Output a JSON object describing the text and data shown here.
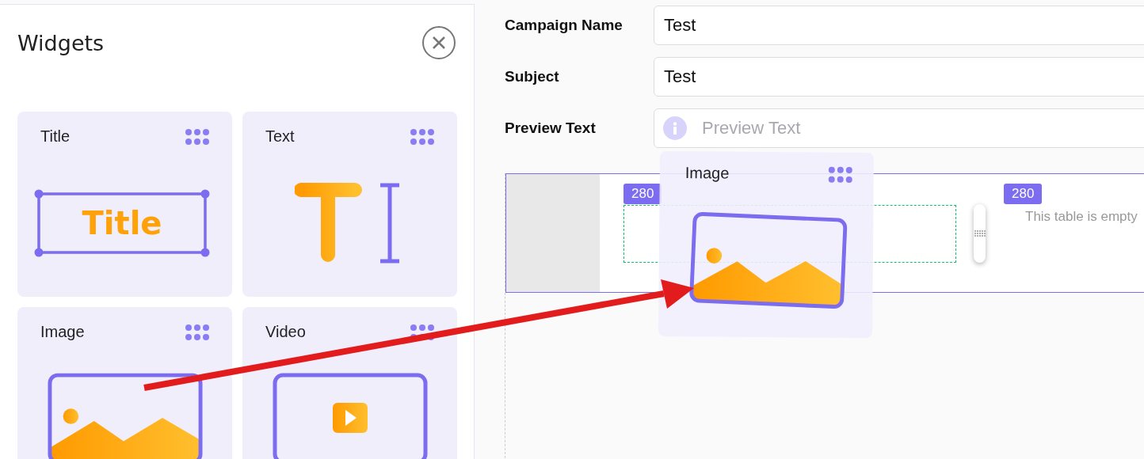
{
  "panel": {
    "title": "Widgets"
  },
  "widgets": [
    {
      "label": "Title",
      "kind": "title",
      "preview": "Title"
    },
    {
      "label": "Text",
      "kind": "text"
    },
    {
      "label": "Image",
      "kind": "image"
    },
    {
      "label": "Video",
      "kind": "video"
    }
  ],
  "form": [
    {
      "label": "Campaign Name",
      "value": "Test"
    },
    {
      "label": "Subject",
      "value": "Test"
    },
    {
      "label": "Preview Text",
      "placeholder": "Preview Text"
    }
  ],
  "canvas": {
    "columns": [
      {
        "width_badge": "280"
      },
      {
        "width_badge": "280",
        "empty_text": "This table is empty"
      }
    ]
  },
  "drag_ghost": {
    "label": "Image",
    "kind": "image"
  }
}
